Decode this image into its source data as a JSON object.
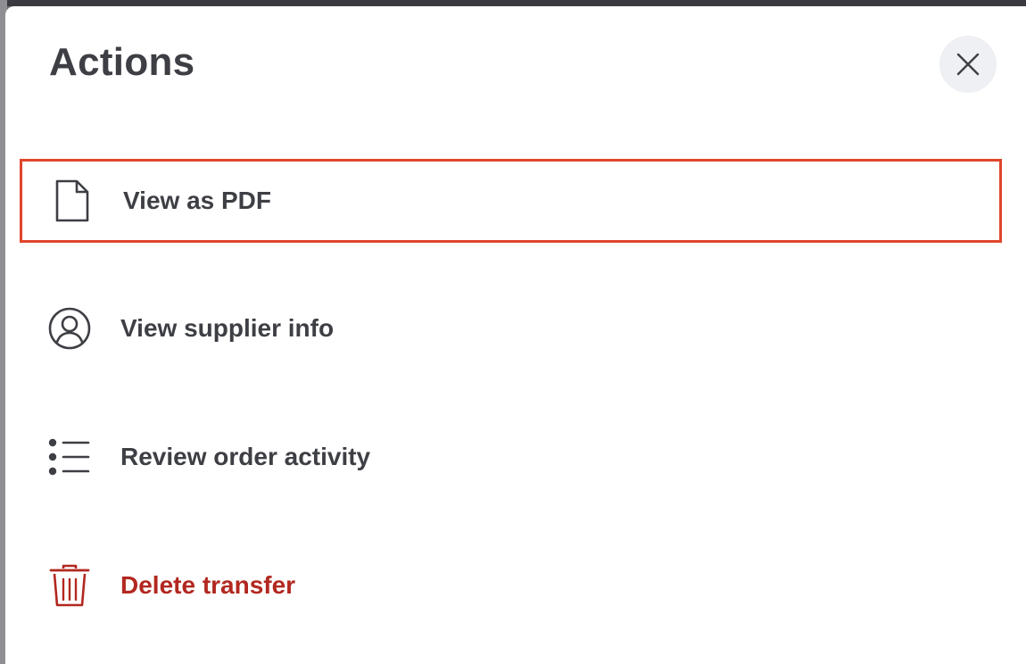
{
  "dialog": {
    "title": "Actions",
    "close_icon": "close-icon"
  },
  "actions": [
    {
      "label": "View as PDF",
      "icon": "document-icon",
      "focused": true
    },
    {
      "label": "View supplier info",
      "icon": "user-circle-icon"
    },
    {
      "label": "Review order activity",
      "icon": "list-icon"
    },
    {
      "label": "Delete transfer",
      "icon": "trash-icon",
      "danger": true
    }
  ],
  "colors": {
    "text": "#3d3f44",
    "danger": "#b22820",
    "focus_ring": "#e0452b",
    "close_button_bg": "#eef0f3"
  }
}
